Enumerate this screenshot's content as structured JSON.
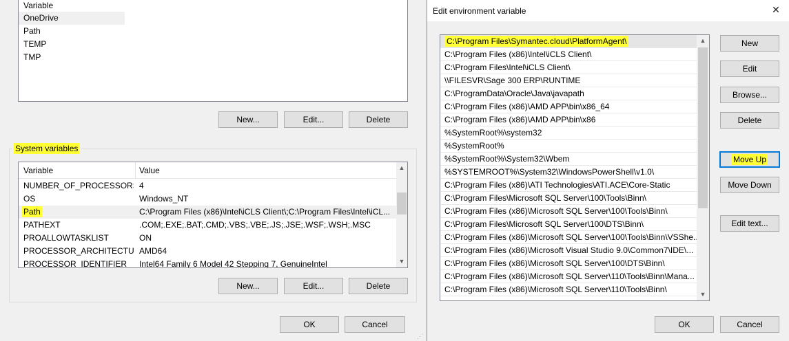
{
  "left": {
    "user_vars": {
      "header_variable": "Variable",
      "rows": [
        "OneDrive",
        "Path",
        "TEMP",
        "TMP"
      ],
      "buttons": {
        "new": "New...",
        "edit": "Edit...",
        "delete": "Delete"
      }
    },
    "system_vars": {
      "title": "System variables",
      "header_variable": "Variable",
      "header_value": "Value",
      "rows": [
        {
          "name": "NUMBER_OF_PROCESSORS",
          "value": "4"
        },
        {
          "name": "OS",
          "value": "Windows_NT"
        },
        {
          "name": "Path",
          "value": "C:\\Program Files (x86)\\Intel\\iCLS Client\\;C:\\Program Files\\Intel\\iCL..."
        },
        {
          "name": "PATHEXT",
          "value": ".COM;.EXE;.BAT;.CMD;.VBS;.VBE;.JS;.JSE;.WSF;.WSH;.MSC"
        },
        {
          "name": "PROALLOWTASKLIST",
          "value": "ON"
        },
        {
          "name": "PROCESSOR_ARCHITECTURE",
          "value": "AMD64"
        },
        {
          "name": "PROCESSOR_IDENTIFIER",
          "value": "Intel64 Family 6 Model 42 Stepping 7, GenuineIntel"
        }
      ],
      "buttons": {
        "new": "New...",
        "edit": "Edit...",
        "delete": "Delete"
      }
    },
    "footer": {
      "ok": "OK",
      "cancel": "Cancel"
    }
  },
  "right": {
    "title": "Edit environment variable",
    "close_glyph": "✕",
    "paths": [
      "C:\\Program Files\\Symantec.cloud\\PlatformAgent\\",
      "C:\\Program Files (x86)\\Intel\\iCLS Client\\",
      "C:\\Program Files\\Intel\\iCLS Client\\",
      "\\\\FILESVR\\Sage 300 ERP\\RUNTIME",
      "C:\\ProgramData\\Oracle\\Java\\javapath",
      "C:\\Program Files (x86)\\AMD APP\\bin\\x86_64",
      "C:\\Program Files (x86)\\AMD APP\\bin\\x86",
      "%SystemRoot%\\system32",
      "%SystemRoot%",
      "%SystemRoot%\\System32\\Wbem",
      "%SYSTEMROOT%\\System32\\WindowsPowerShell\\v1.0\\",
      "C:\\Program Files (x86)\\ATI Technologies\\ATI.ACE\\Core-Static",
      "C:\\Program Files\\Microsoft SQL Server\\100\\Tools\\Binn\\",
      "C:\\Program Files (x86)\\Microsoft SQL Server\\100\\Tools\\Binn\\",
      "C:\\Program Files\\Microsoft SQL Server\\100\\DTS\\Binn\\",
      "C:\\Program Files (x86)\\Microsoft SQL Server\\100\\Tools\\Binn\\VSShe...",
      "C:\\Program Files (x86)\\Microsoft Visual Studio 9.0\\Common7\\IDE\\...",
      "C:\\Program Files (x86)\\Microsoft SQL Server\\100\\DTS\\Binn\\",
      "C:\\Program Files (x86)\\Microsoft SQL Server\\110\\Tools\\Binn\\Mana...",
      "C:\\Program Files (x86)\\Microsoft SQL Server\\110\\Tools\\Binn\\"
    ],
    "buttons": {
      "new": "New",
      "edit": "Edit",
      "browse": "Browse...",
      "delete": "Delete",
      "move_up": "Move Up",
      "move_down": "Move Down",
      "edit_text": "Edit text..."
    },
    "footer": {
      "ok": "OK",
      "cancel": "Cancel"
    }
  },
  "colors": {
    "highlight": "#ffff33",
    "focus": "#0078d7",
    "window_bg": "#f0f0f0"
  }
}
